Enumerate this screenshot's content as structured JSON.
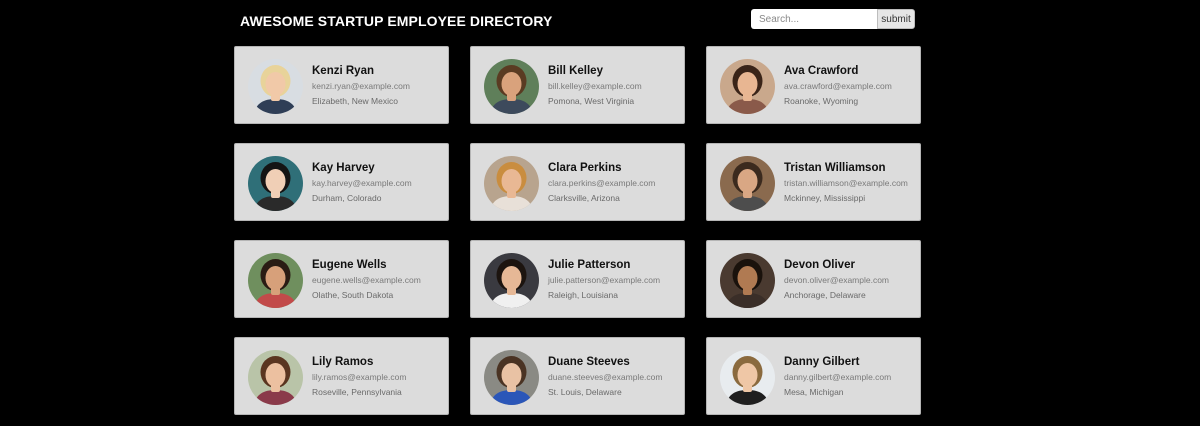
{
  "header": {
    "title": "AWESOME STARTUP EMPLOYEE DIRECTORY",
    "search_placeholder": "Search...",
    "submit_label": "submit"
  },
  "employees": [
    {
      "name": "Kenzi Ryan",
      "email": "kenzi.ryan@example.com",
      "location": "Elizabeth, New Mexico",
      "avatar": {
        "bg": "#d8dde2",
        "skin": "#f1c9a8",
        "hair": "#e8d39a",
        "shirt": "#2f3e56"
      }
    },
    {
      "name": "Bill Kelley",
      "email": "bill.kelley@example.com",
      "location": "Pomona, West Virginia",
      "avatar": {
        "bg": "#5f7f5a",
        "skin": "#d9a27c",
        "hair": "#5a3b22",
        "shirt": "#3d4a5c"
      }
    },
    {
      "name": "Ava Crawford",
      "email": "ava.crawford@example.com",
      "location": "Roanoke, Wyoming",
      "avatar": {
        "bg": "#c9a88c",
        "skin": "#e8b692",
        "hair": "#3a2418",
        "shirt": "#8a5a4a"
      }
    },
    {
      "name": "Kay Harvey",
      "email": "kay.harvey@example.com",
      "location": "Durham, Colorado",
      "avatar": {
        "bg": "#2f6f78",
        "skin": "#f0cfb6",
        "hair": "#141414",
        "shirt": "#2a2a2a"
      }
    },
    {
      "name": "Clara Perkins",
      "email": "clara.perkins@example.com",
      "location": "Clarksville, Arizona",
      "avatar": {
        "bg": "#b8a48e",
        "skin": "#e9b894",
        "hair": "#c98d3f",
        "shirt": "#e8e0d8"
      }
    },
    {
      "name": "Tristan Williamson",
      "email": "tristan.williamson@example.com",
      "location": "Mckinney, Mississippi",
      "avatar": {
        "bg": "#8a6a4e",
        "skin": "#d9a784",
        "hair": "#3b2a1e",
        "shirt": "#4d4d4d"
      }
    },
    {
      "name": "Eugene Wells",
      "email": "eugene.wells@example.com",
      "location": "Olathe, South Dakota",
      "avatar": {
        "bg": "#6f8f5e",
        "skin": "#d7a07a",
        "hair": "#2a1c14",
        "shirt": "#c24a4a"
      }
    },
    {
      "name": "Julie Patterson",
      "email": "julie.patterson@example.com",
      "location": "Raleigh, Louisiana",
      "avatar": {
        "bg": "#3a3a40",
        "skin": "#e6b896",
        "hair": "#1c140f",
        "shirt": "#f0f0f0"
      }
    },
    {
      "name": "Devon Oliver",
      "email": "devon.oliver@example.com",
      "location": "Anchorage, Delaware",
      "avatar": {
        "bg": "#4a3a30",
        "skin": "#b07a52",
        "hair": "#1a120c",
        "shirt": "#3a2e28"
      }
    },
    {
      "name": "Lily Ramos",
      "email": "lily.ramos@example.com",
      "location": "Roseville, Pennsylvania",
      "avatar": {
        "bg": "#b9c4a8",
        "skin": "#ecc0a0",
        "hair": "#5a3520",
        "shirt": "#8a3a4a"
      }
    },
    {
      "name": "Duane Steeves",
      "email": "duane.steeves@example.com",
      "location": "St. Louis, Delaware",
      "avatar": {
        "bg": "#8a8a84",
        "skin": "#e9c2a4",
        "hair": "#4a3323",
        "shirt": "#2b56b8"
      }
    },
    {
      "name": "Danny Gilbert",
      "email": "danny.gilbert@example.com",
      "location": "Mesa, Michigan",
      "avatar": {
        "bg": "#e8ecef",
        "skin": "#efc7a6",
        "hair": "#8a6a3e",
        "shirt": "#1f1f1f"
      }
    }
  ]
}
